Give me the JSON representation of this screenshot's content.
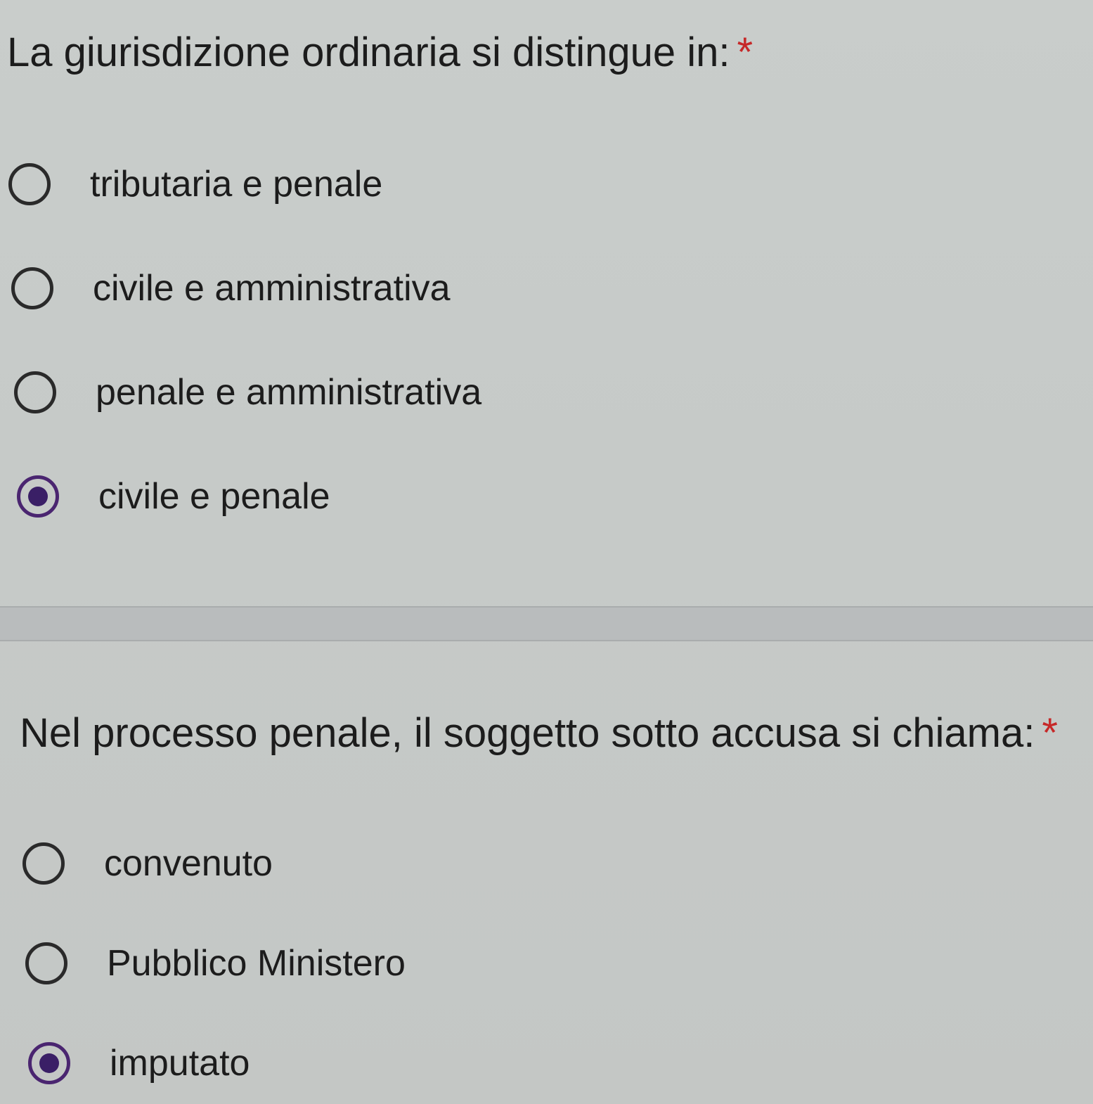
{
  "questions": [
    {
      "title": "La giurisdizione ordinaria si distingue in:",
      "required_mark": "*",
      "options": [
        {
          "label": "tributaria e penale",
          "selected": false
        },
        {
          "label": "civile e amministrativa",
          "selected": false
        },
        {
          "label": "penale e amministrativa",
          "selected": false
        },
        {
          "label": "civile e penale",
          "selected": true
        }
      ]
    },
    {
      "title": "Nel processo penale, il soggetto sotto accusa si chiama:",
      "required_mark": "*",
      "options": [
        {
          "label": "convenuto",
          "selected": false
        },
        {
          "label": "Pubblico Ministero",
          "selected": false
        },
        {
          "label": "imputato",
          "selected": true
        }
      ]
    }
  ],
  "colors": {
    "required": "#c62828",
    "radio_selected": "#3a1f66",
    "radio_unselected": "#2a2a2a"
  }
}
